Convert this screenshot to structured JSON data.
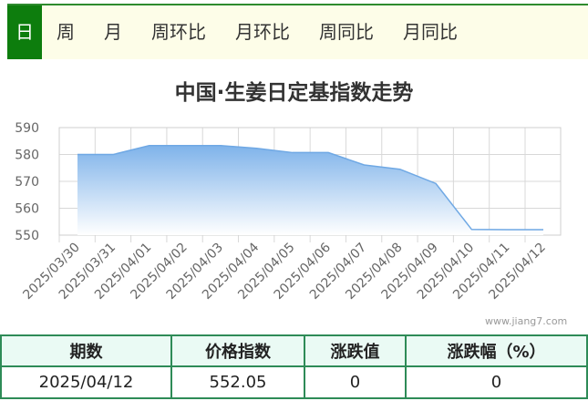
{
  "tabs": [
    "日",
    "周",
    "月",
    "周环比",
    "月环比",
    "周同比",
    "月同比"
  ],
  "active_tab": 0,
  "watermark": "www.jiang7.com",
  "table": {
    "headers": [
      "期数",
      "价格指数",
      "涨跌值",
      "涨跌幅（%）"
    ],
    "row": [
      "2025/04/12",
      "552.05",
      "0",
      "0"
    ]
  },
  "colors": {
    "accent": "#0d7d0d",
    "area_top": "#7fb3ea",
    "area_bottom": "#ffffff",
    "border": "#2e8b57"
  },
  "chart_data": {
    "type": "area",
    "title": "中国·生姜日定基指数走势",
    "x": [
      "2025/03/30",
      "2025/03/31",
      "2025/04/01",
      "2025/04/02",
      "2025/04/03",
      "2025/04/04",
      "2025/04/05",
      "2025/04/06",
      "2025/04/07",
      "2025/04/08",
      "2025/04/09",
      "2025/04/10",
      "2025/04/11",
      "2025/04/12"
    ],
    "values": [
      580.0,
      580.0,
      583.3,
      583.3,
      583.3,
      582.3,
      580.7,
      580.7,
      576.1,
      574.5,
      569.2,
      552.1,
      552.05,
      552.05
    ],
    "ylim": [
      550,
      590
    ],
    "yticks": [
      550,
      560,
      570,
      580,
      590
    ],
    "grid": true
  }
}
